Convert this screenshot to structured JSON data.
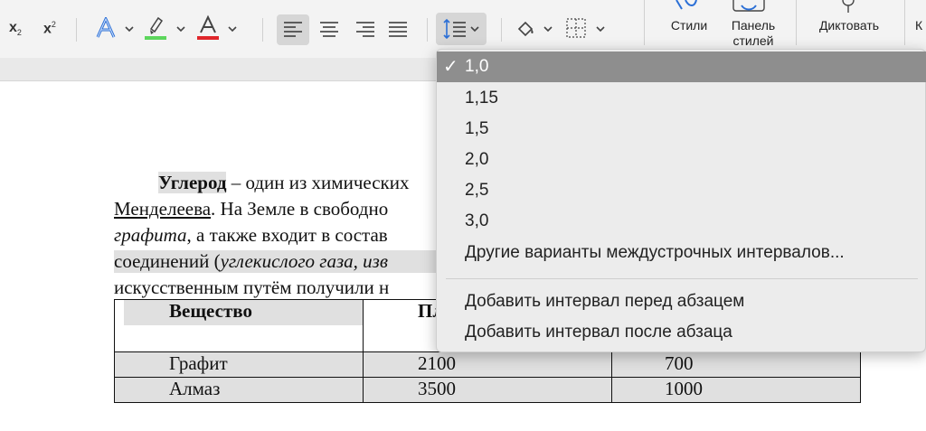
{
  "ribbon": {
    "subscript": {
      "base": "x",
      "mark": "2"
    },
    "superscript": {
      "base": "x",
      "mark": "2"
    },
    "styles_label": "Стили",
    "styles_pane_label_1": "Панель",
    "styles_pane_label_2": "стилей",
    "dictate_label": "Диктовать",
    "edge_label": "К",
    "colors": {
      "highlight": "#5cd65c",
      "font_color": "#e0262b",
      "text_effect": "#2b6fd6",
      "accent": "#2b6fd6"
    }
  },
  "document": {
    "line1_bold": "Углерод",
    "line1_rest": " – один из химических",
    "line2_underline": "Менделеева",
    "line2_rest": ". На Земле в свободно",
    "line3_italic": "графита",
    "line3_rest": ", а также входит в состав",
    "line4_start": "соединений (",
    "line4_italic": "углекислого газа, изв",
    "line5": "искусственным путём получили н",
    "table": {
      "header": [
        "Вещество",
        "Пл",
        ""
      ],
      "rows": [
        [
          "Графит",
          "2100",
          "700"
        ],
        [
          "Алмаз",
          "3500",
          "1000"
        ]
      ]
    }
  },
  "menu": {
    "items": [
      {
        "label": "1,0",
        "selected": true
      },
      {
        "label": "1,15"
      },
      {
        "label": "1,5"
      },
      {
        "label": "2,0"
      },
      {
        "label": "2,5"
      },
      {
        "label": "3,0"
      },
      {
        "label": "Другие варианты междустрочных интервалов..."
      }
    ],
    "check": "✓",
    "spacing_items": [
      {
        "label": "Добавить интервал перед абзацем"
      },
      {
        "label": "Добавить интервал после абзаца"
      }
    ]
  }
}
